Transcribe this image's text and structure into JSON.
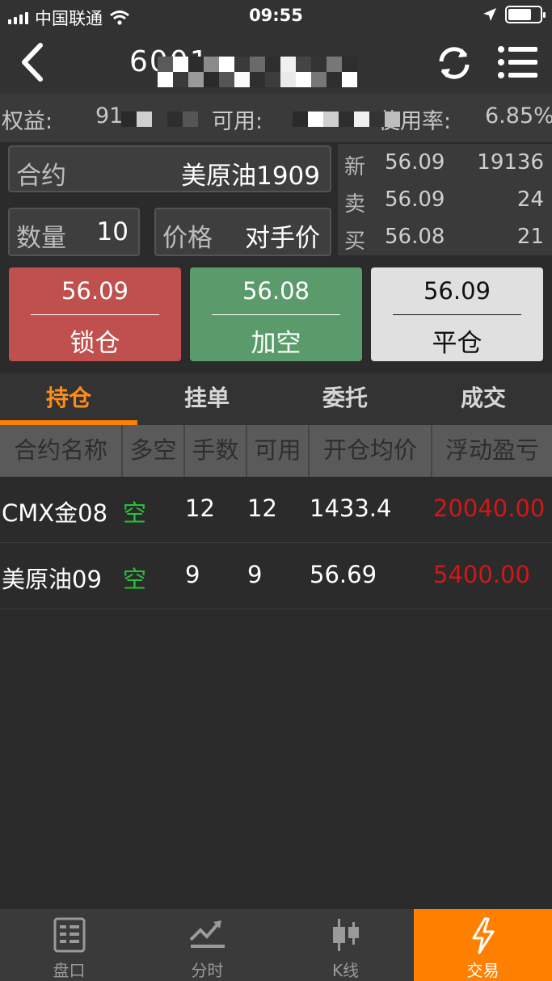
{
  "status_bar": {
    "carrier": "中国联通",
    "time": "09:55"
  },
  "nav": {
    "title_visible": "6001"
  },
  "info": {
    "equity_label": "权益:",
    "equity_value": "91",
    "available_label": "可用:",
    "usage_label": "使用率:",
    "usage_value": "6.85%"
  },
  "order_form": {
    "contract_label": "合约",
    "contract_value": "美原油1909",
    "qty_label": "数量",
    "qty_value": "10",
    "price_label": "价格",
    "price_value": "对手价"
  },
  "quote": {
    "rows": [
      {
        "label": "新",
        "price": "56.09",
        "volume": "19136"
      },
      {
        "label": "卖",
        "price": "56.09",
        "volume": "24"
      },
      {
        "label": "买",
        "price": "56.08",
        "volume": "21"
      }
    ]
  },
  "actions": [
    {
      "price": "56.09",
      "label": "锁仓",
      "bg": "#c0504d",
      "fg": "#ffffff"
    },
    {
      "price": "56.08",
      "label": "加空",
      "bg": "#5b9b6b",
      "fg": "#ffffff"
    },
    {
      "price": "56.09",
      "label": "平仓",
      "bg": "#e0e0e0",
      "fg": "#111111"
    }
  ],
  "tabs": [
    "持仓",
    "挂单",
    "委托",
    "成交"
  ],
  "active_tab": "持仓",
  "table": {
    "headers": [
      "合约名称",
      "多空",
      "手数",
      "可用",
      "开仓均价",
      "浮动盈亏"
    ],
    "rows": [
      {
        "name": "CMX金08",
        "side": "空",
        "lots": "12",
        "avail": "12",
        "avg": "1433.4",
        "pnl": "20040.00"
      },
      {
        "name": "美原油09",
        "side": "空",
        "lots": "9",
        "avail": "9",
        "avg": "56.69",
        "pnl": "5400.00"
      }
    ]
  },
  "colors": {
    "accent": "#ff8000",
    "short_side": "#22c33a",
    "pnl": "#d01818"
  },
  "bottom_tabs": [
    {
      "label": "盘口",
      "icon": "orderbook-icon"
    },
    {
      "label": "分时",
      "icon": "timeshare-icon"
    },
    {
      "label": "K线",
      "icon": "candlestick-icon"
    },
    {
      "label": "交易",
      "icon": "lightning-icon"
    }
  ],
  "active_bottom_tab": "交易"
}
